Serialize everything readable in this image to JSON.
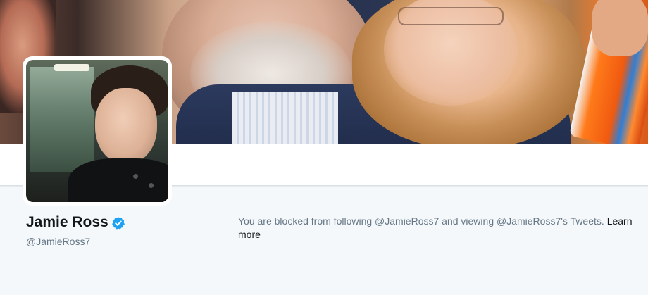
{
  "profile": {
    "name": "Jamie Ross",
    "screen_name": "@JamieRoss7",
    "verified": true
  },
  "blocked_notice": {
    "message": "You are blocked from following @JamieRoss7 and viewing @JamieRoss7's Tweets. ",
    "link_label": "Learn more"
  },
  "colors": {
    "page_background": "#f5f8fa",
    "verified_badge": "#1da1f2",
    "name_text": "#14171a",
    "secondary_text": "#657786"
  },
  "icons": {
    "verified": "verified-badge-icon"
  }
}
